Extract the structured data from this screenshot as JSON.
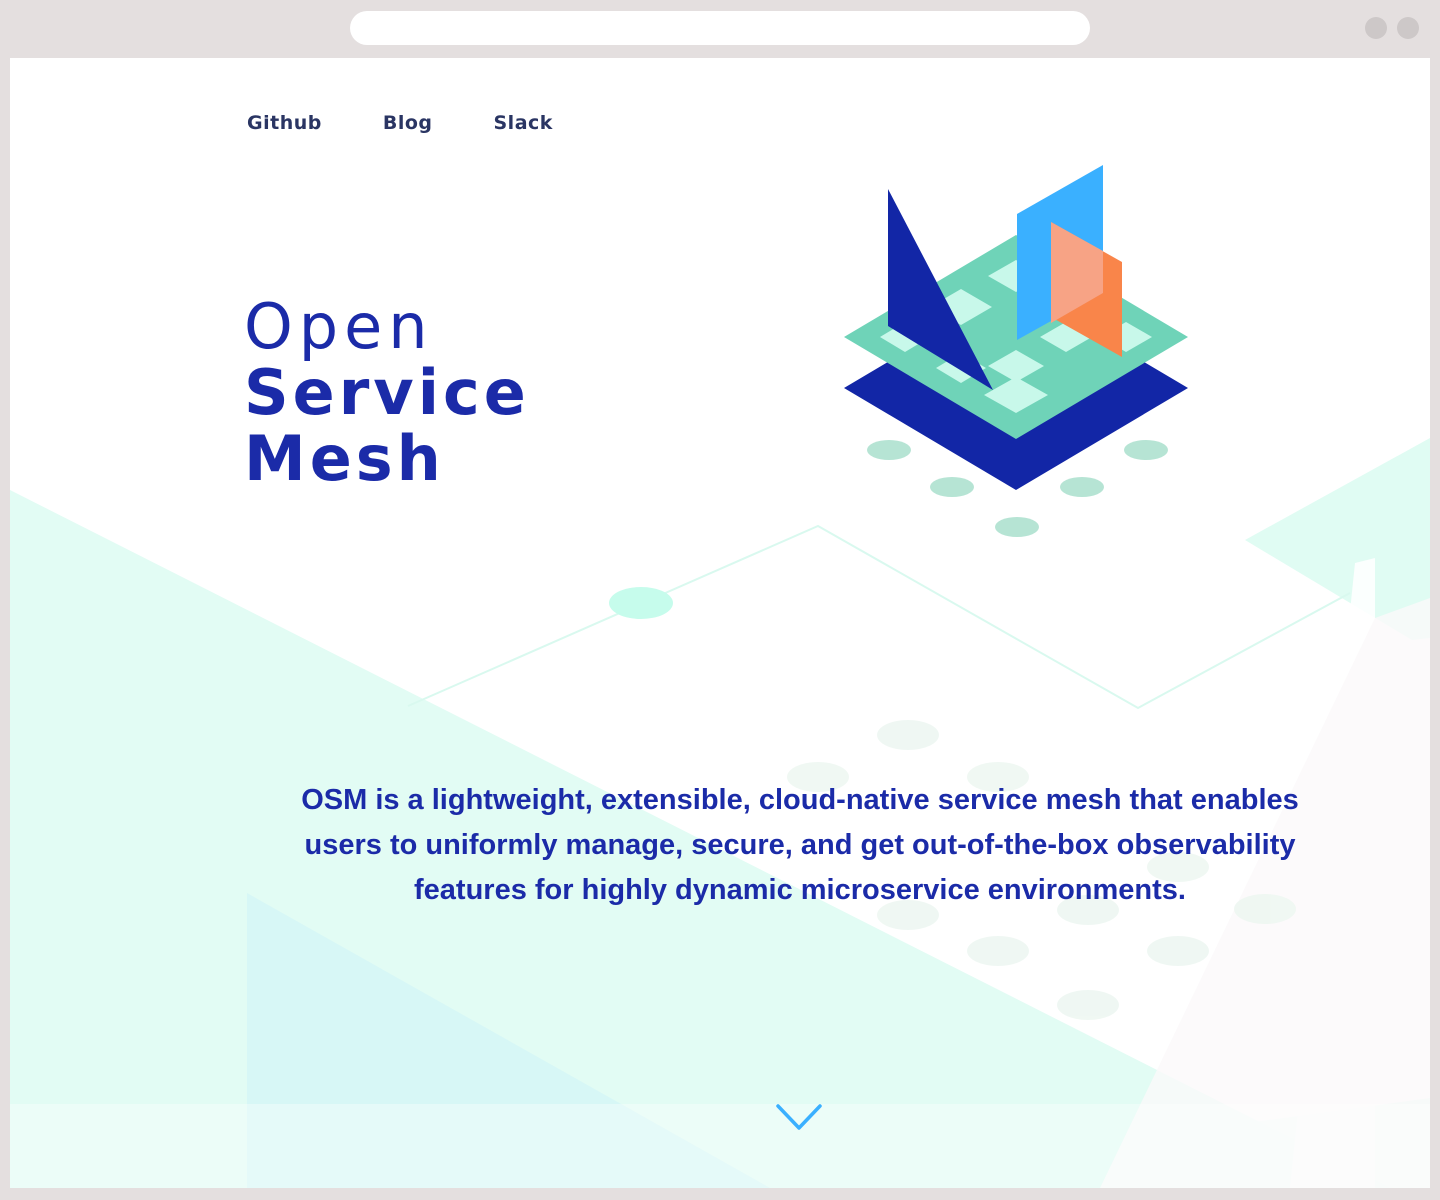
{
  "nav": {
    "items": [
      {
        "label": "Github"
      },
      {
        "label": "Blog"
      },
      {
        "label": "Slack"
      }
    ]
  },
  "hero": {
    "title_lines": [
      "Open",
      "Service",
      "Mesh"
    ],
    "description": "OSM is a lightweight, extensible, cloud-native service mesh that enables users to uniformly manage, secure, and get out-of-the-box observability features for highly dynamic microservice environments."
  },
  "icons": {
    "scroll": "chevron-down-icon"
  },
  "colors": {
    "brand_blue": "#1b2ba8",
    "nav_text": "#2a3563",
    "mint": "#6fd3b8",
    "sky_blue": "#3ab0ff",
    "orange": "#f9854a",
    "background_mint": "#e0fcf3"
  }
}
